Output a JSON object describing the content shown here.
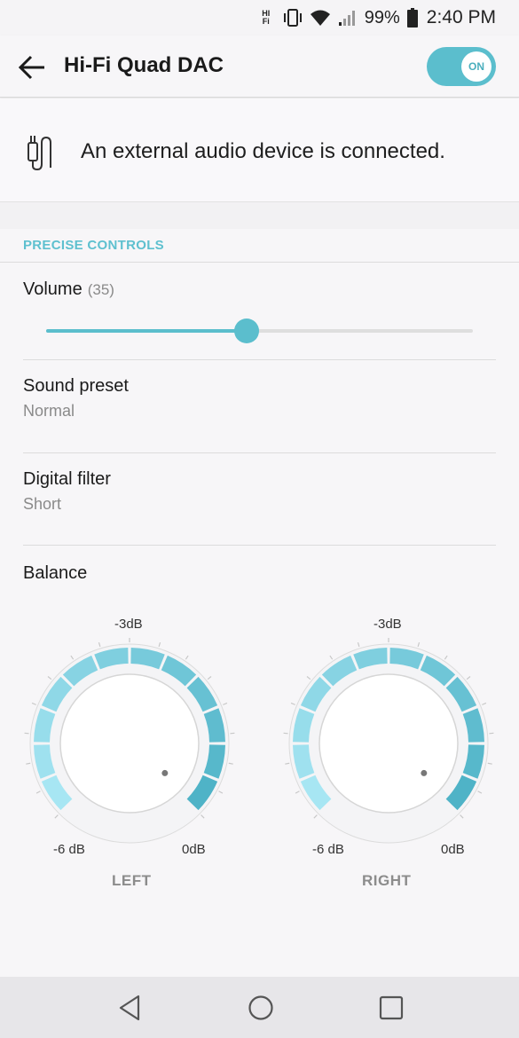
{
  "status_bar": {
    "hifi_icon_top": "HI",
    "hifi_icon_bottom": "Fi",
    "battery_percent": "99%",
    "time": "2:40 PM",
    "icons": [
      "hifi-icon",
      "vibrate-icon",
      "wifi-icon",
      "signal-icon",
      "battery-icon"
    ]
  },
  "app_bar": {
    "title": "Hi-Fi Quad DAC",
    "toggle_label": "ON",
    "toggle_on": true
  },
  "banner": {
    "text": "An external audio device is connected.",
    "icon": "audio-cable-icon"
  },
  "precise_controls": {
    "header": "PRECISE CONTROLS",
    "volume": {
      "label": "Volume",
      "value": "(35)",
      "level_fraction": 0.47
    },
    "sound_preset": {
      "label": "Sound preset",
      "value": "Normal"
    },
    "digital_filter": {
      "label": "Digital filter",
      "value": "Short"
    },
    "balance": {
      "label": "Balance",
      "left": {
        "top_label": "-3dB",
        "min_label": "-6 dB",
        "max_label": "0dB",
        "name": "LEFT"
      },
      "right": {
        "top_label": "-3dB",
        "min_label": "-6 dB",
        "max_label": "0dB",
        "name": "RIGHT"
      }
    }
  },
  "nav_bar": {
    "icons": [
      "back-triangle-icon",
      "home-circle-icon",
      "recents-square-icon"
    ]
  },
  "colors": {
    "accent": "#5bbecd",
    "section_header": "#5ec0cf",
    "secondary_text": "#8a8a8a"
  }
}
